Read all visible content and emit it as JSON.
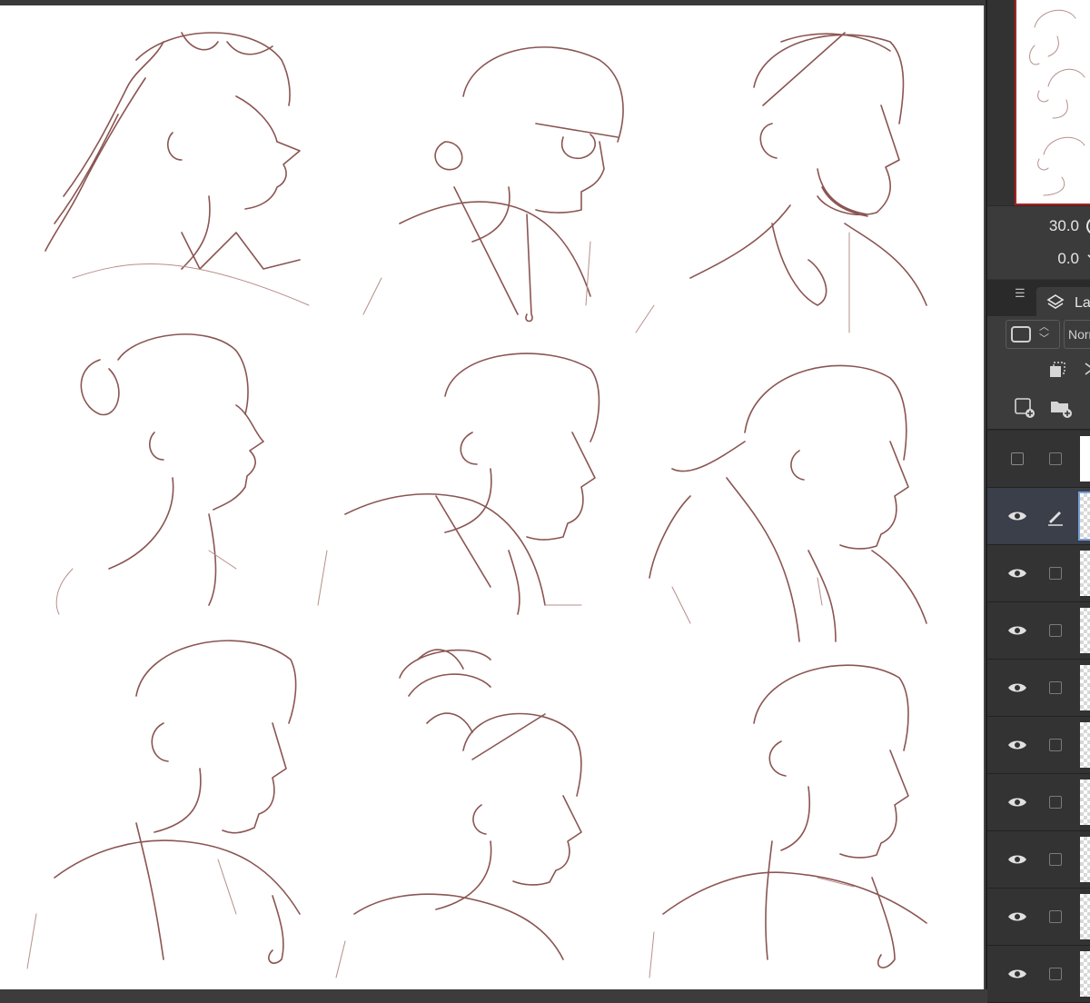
{
  "app": {
    "title": ""
  },
  "canvas": {
    "sketches": [
      {
        "id": "portrait-1",
        "desc": "woman curly hair"
      },
      {
        "id": "portrait-2",
        "desc": "woman with glasses"
      },
      {
        "id": "portrait-3",
        "desc": "bearded man sunglasses"
      },
      {
        "id": "portrait-4",
        "desc": "woman hair bun"
      },
      {
        "id": "portrait-5",
        "desc": "young man scrubs"
      },
      {
        "id": "portrait-6",
        "desc": "woman ponytail hoodie"
      },
      {
        "id": "portrait-7",
        "desc": "man stethoscope"
      },
      {
        "id": "portrait-8",
        "desc": "woman messy bun"
      },
      {
        "id": "portrait-9",
        "desc": "man short hair stethoscope"
      }
    ],
    "stroke_color": "#8a5552"
  },
  "navigator": {
    "zoom_value": "30.0",
    "rotation_value": "0.0",
    "frame_color": "#b31e1e"
  },
  "layers": {
    "tab_label": "La",
    "blend_mode": "Norm",
    "rows": [
      {
        "visible": false,
        "edit": false,
        "thumb": "plain"
      },
      {
        "visible": true,
        "edit": true,
        "thumb": "selected"
      },
      {
        "visible": true,
        "edit": false,
        "thumb": "checker"
      },
      {
        "visible": true,
        "edit": false,
        "thumb": "checker"
      },
      {
        "visible": true,
        "edit": false,
        "thumb": "checker"
      },
      {
        "visible": true,
        "edit": false,
        "thumb": "checker"
      },
      {
        "visible": true,
        "edit": false,
        "thumb": "checker"
      },
      {
        "visible": true,
        "edit": false,
        "thumb": "checker"
      },
      {
        "visible": true,
        "edit": false,
        "thumb": "checker"
      },
      {
        "visible": true,
        "edit": false,
        "thumb": "checker"
      }
    ]
  }
}
